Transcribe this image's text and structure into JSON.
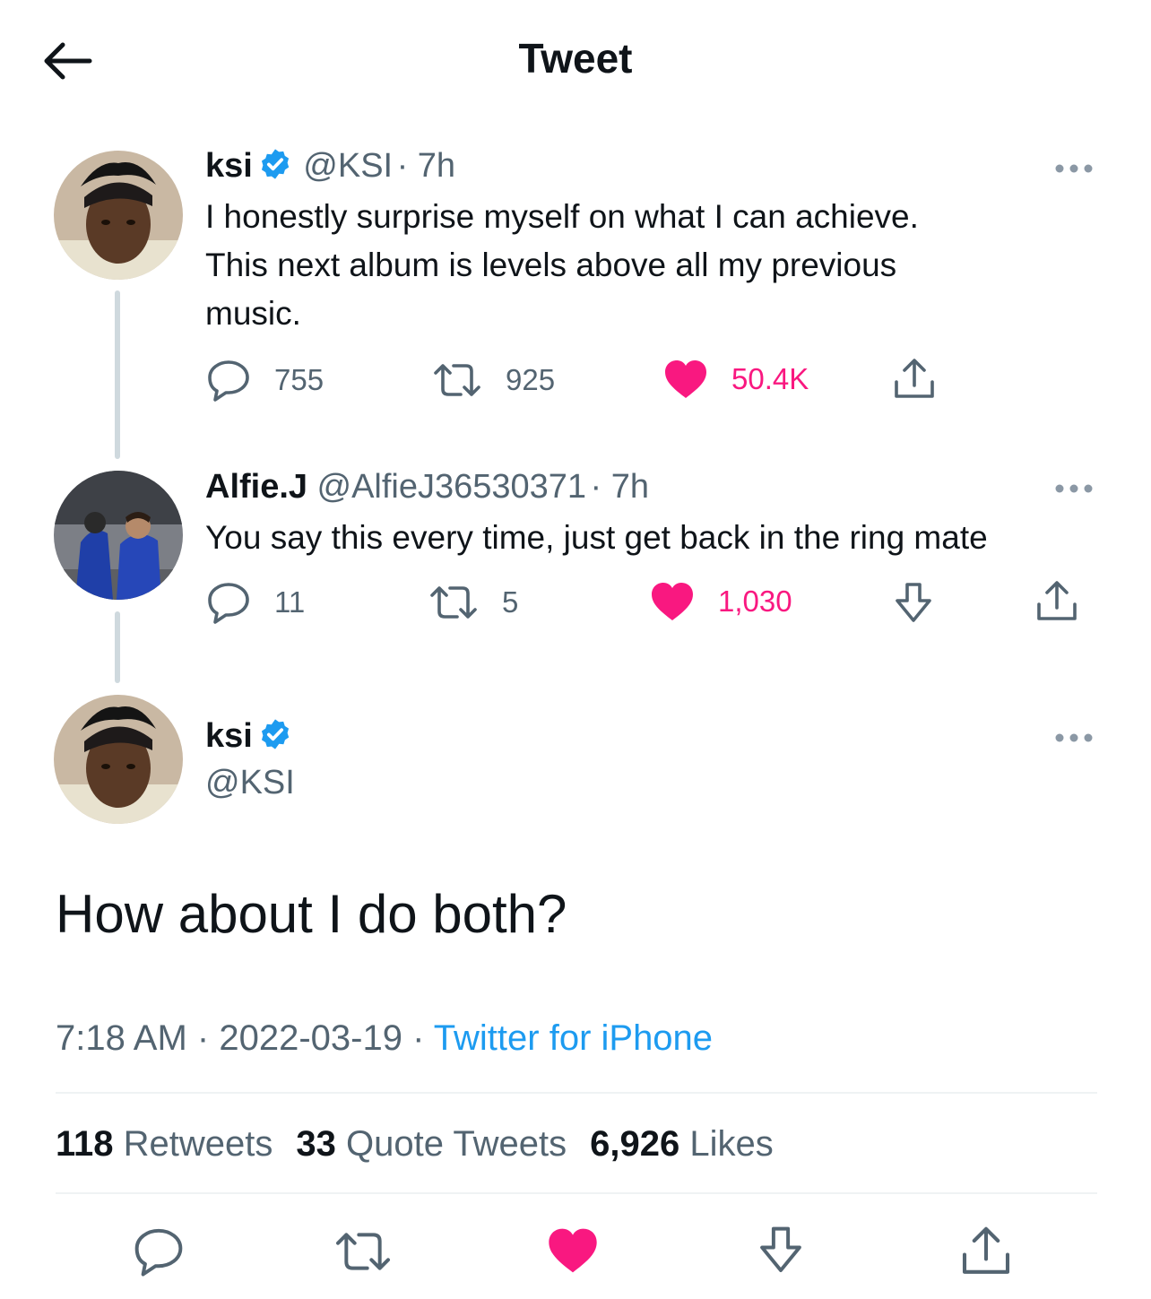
{
  "header": {
    "title": "Tweet"
  },
  "colors": {
    "like": "#f91880",
    "verified": "#1d9bf0",
    "link": "#1d9bf0",
    "muted": "#536471"
  },
  "tweet1": {
    "name": "ksi",
    "handle": "@KSI",
    "time": "· 7h",
    "text_lines": [
      "I honestly surprise myself on what I can achieve.",
      "This next album is levels above all my previous",
      "music."
    ],
    "replies": "755",
    "retweets": "925",
    "likes": "50.4K"
  },
  "tweet2": {
    "name": "Alfie.J",
    "handle": "@AlfieJ36530371",
    "time": "· 7h",
    "text": "You say this every time, just get back in the ring mate",
    "replies": "11",
    "retweets": "5",
    "likes": "1,030"
  },
  "main": {
    "name": "ksi",
    "handle": "@KSI",
    "text": "How about I do both?",
    "time": "7:18 AM",
    "date": "2022-03-19",
    "sep": "·",
    "source": "Twitter for iPhone",
    "retweets_count": "118",
    "retweets_label": "Retweets",
    "quotes_count": "33",
    "quotes_label": "Quote Tweets",
    "likes_count": "6,926",
    "likes_label": "Likes"
  }
}
